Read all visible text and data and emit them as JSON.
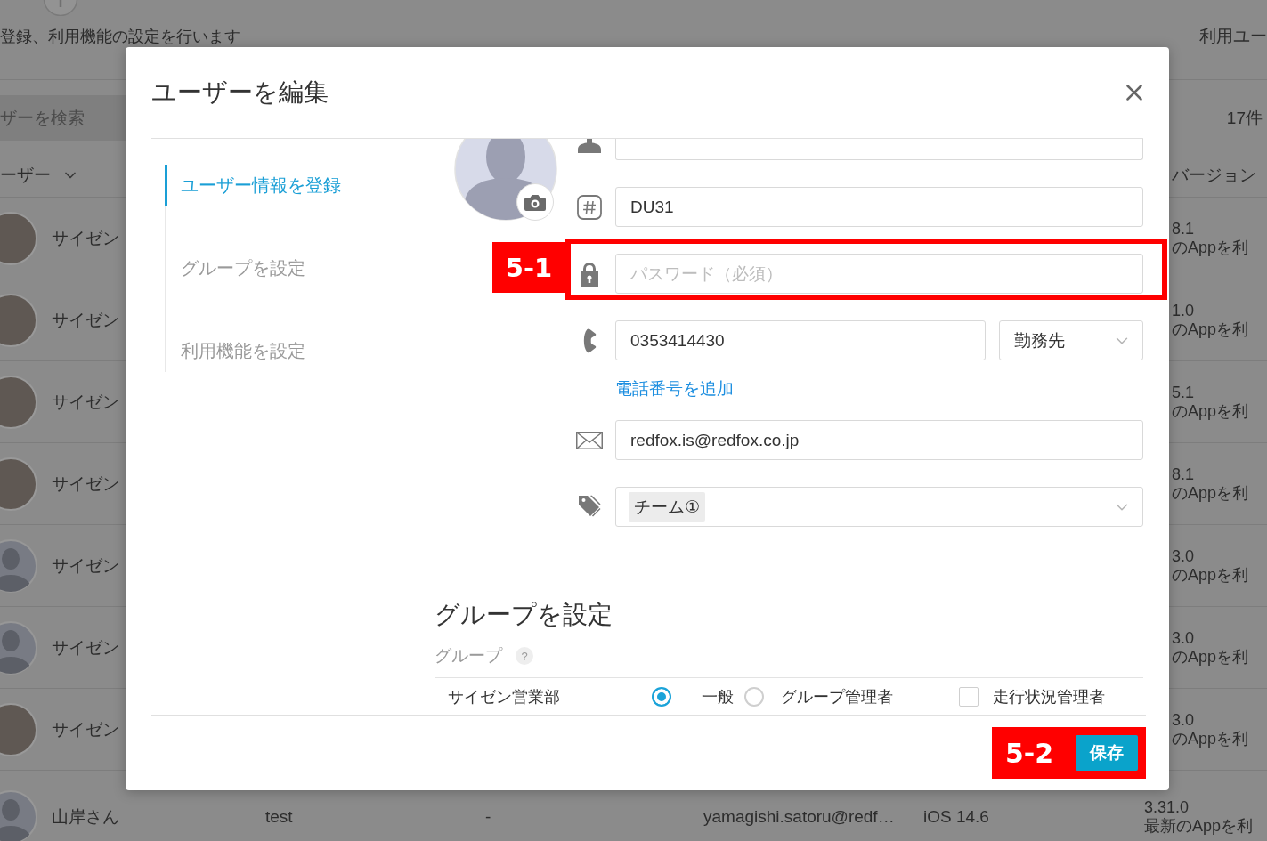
{
  "background": {
    "subtitle": "登録、利用機能の設定を行います",
    "header_right": "利用ユー",
    "search": {
      "placeholder": "ザーを検索"
    },
    "count": "17件",
    "columns": [
      {
        "label": "ーザー",
        "sortable": true
      },
      {
        "label": "バージョン",
        "sortable": false
      }
    ],
    "rows": [
      {
        "kind": "covered",
        "avatar": {
          "kind": "photo"
        },
        "name": "サイゼン",
        "version": "8.1",
        "note": "のAppを利"
      },
      {
        "kind": "covered",
        "avatar": {
          "kind": "photo"
        },
        "name": "サイゼン",
        "version": "1.0",
        "note": "のAppを利"
      },
      {
        "kind": "covered",
        "avatar": {
          "kind": "photo"
        },
        "name": "サイゼン",
        "version": "5.1",
        "note": "のAppを利"
      },
      {
        "kind": "covered",
        "avatar": {
          "kind": "photo"
        },
        "name": "サイゼン",
        "version": "8.1",
        "note": "のAppを利"
      },
      {
        "kind": "covered",
        "avatar": {
          "kind": "silhouette"
        },
        "name": "サイゼン",
        "version": "3.0",
        "note": "のAppを利"
      },
      {
        "kind": "covered",
        "avatar": {
          "kind": "silhouette"
        },
        "name": "サイゼン",
        "version": "3.0",
        "note": "のAppを利"
      },
      {
        "kind": "covered",
        "avatar": {
          "kind": "photo"
        },
        "name": "サイゼン",
        "version": "3.0",
        "note": "のAppを利"
      },
      {
        "kind": "full",
        "avatar": {
          "kind": "silhouette"
        },
        "name": "山岸さん",
        "column_3": "test",
        "column_4": "-",
        "email": "yamagishi.satoru@redf…",
        "os": "iOS 14.6",
        "version": "3.31.0",
        "note": "最新のAppを利"
      }
    ]
  },
  "dialog": {
    "title": "ユーザーを編集",
    "nav": [
      {
        "label": "ユーザー情報を登録",
        "selected": true
      },
      {
        "label": "グループを設定",
        "selected": false
      },
      {
        "label": "利用機能を設定",
        "selected": false
      }
    ],
    "fields": [
      {
        "kind": "name"
      },
      {
        "kind": "code",
        "value": "DU31"
      },
      {
        "kind": "password",
        "placeholder": "パスワード（必須）",
        "annotation": "5-1"
      },
      {
        "kind": "phone",
        "value": "0353414430",
        "phone_type": "勤務先",
        "add_link": "電話番号を追加"
      },
      {
        "kind": "email",
        "value": "redfox.is@redfox.co.jp"
      },
      {
        "kind": "tags",
        "tags": [
          "チーム①"
        ]
      }
    ],
    "groups": {
      "heading": "グループを設定",
      "label": "グループ",
      "help_mark": "?",
      "rows": [
        {
          "name": "サイゼン営業部",
          "roles": [
            {
              "label": "一般",
              "selected": true
            },
            {
              "label": "グループ管理者",
              "selected": false
            }
          ],
          "tracking": {
            "label": "走行状況管理者",
            "checked": false
          }
        }
      ]
    },
    "footer": {
      "save_button": "保存",
      "annotation": "5-2"
    }
  }
}
